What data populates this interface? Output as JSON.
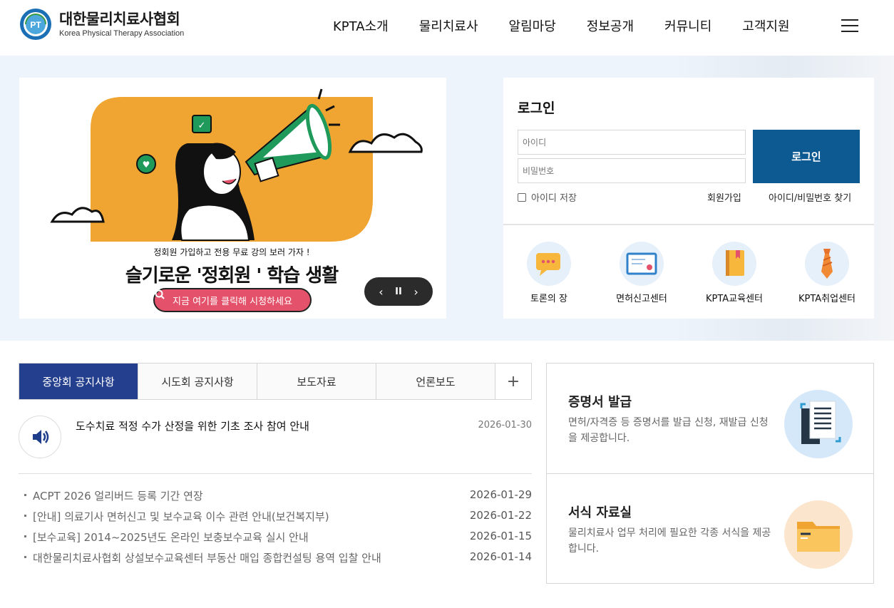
{
  "header": {
    "logo_ko": "대한물리치료사협회",
    "logo_en": "Korea Physical Therapy Association",
    "logo_mark": "PT",
    "nav": [
      "KPTA소개",
      "물리치료사",
      "알림마당",
      "정보공개",
      "커뮤니티",
      "고객지원"
    ]
  },
  "banner": {
    "subtitle": "정회원 가입하고 전용 무료 강의 보러 가자 !",
    "title": "슬기로운 '정회원 ' 학습 생활",
    "cta": "지금 여기를 클릭해 시청하세요",
    "controls": {
      "prev": "‹",
      "pause": "II",
      "next": "›"
    },
    "colors": {
      "bubble": "#f0a431",
      "cta": "#e3526a",
      "megaphone": "#1f9a5b"
    }
  },
  "login": {
    "title": "로그인",
    "id_placeholder": "아이디",
    "pw_placeholder": "비밀번호",
    "button": "로그인",
    "remember": "아이디 저장",
    "join": "회원가입",
    "find": "아이디/비밀번호 찾기",
    "quick_links": [
      {
        "label": "토론의 장",
        "icon": "chat-bubble-icon"
      },
      {
        "label": "면허신고센터",
        "icon": "certificate-icon"
      },
      {
        "label": "KPTA교육센터",
        "icon": "book-icon"
      },
      {
        "label": "KPTA취업센터",
        "icon": "necktie-icon"
      }
    ]
  },
  "notice": {
    "tabs": [
      "중앙회 공지사항",
      "시도회 공지사항",
      "보도자료",
      "언론보도"
    ],
    "more": "+",
    "featured": {
      "title": "도수치료 적정 수가 산정을 위한 기초 조사 참여 안내",
      "date": "2026-01-30"
    },
    "items": [
      {
        "title": "ACPT 2026 얼리버드 등록 기간 연장",
        "date": "2026-01-29"
      },
      {
        "title": "[안내] 의료기사 면허신고 및 보수교육 이수 관련 안내(보건복지부)",
        "date": "2026-01-22"
      },
      {
        "title": "[보수교육] 2014~2025년도 온라인 보충보수교육 실시 안내",
        "date": "2026-01-15"
      },
      {
        "title": "대한물리치료사협회 상설보수교육센터 부동산 매입 종합컨설팅 용역 입찰 안내",
        "date": "2026-01-14"
      }
    ]
  },
  "services": [
    {
      "title": "증명서 발급",
      "desc": "면허/자격증 등 증명서를 발급 신청, 재발급 신청을 제공합니다.",
      "icon": "document-icon",
      "color": "#d4e8f9"
    },
    {
      "title": "서식 자료실",
      "desc": "물리치료사 업무 처리에 필요한 각종 서식을 제공합니다.",
      "icon": "folder-icon",
      "color": "#fbe5cd"
    }
  ]
}
